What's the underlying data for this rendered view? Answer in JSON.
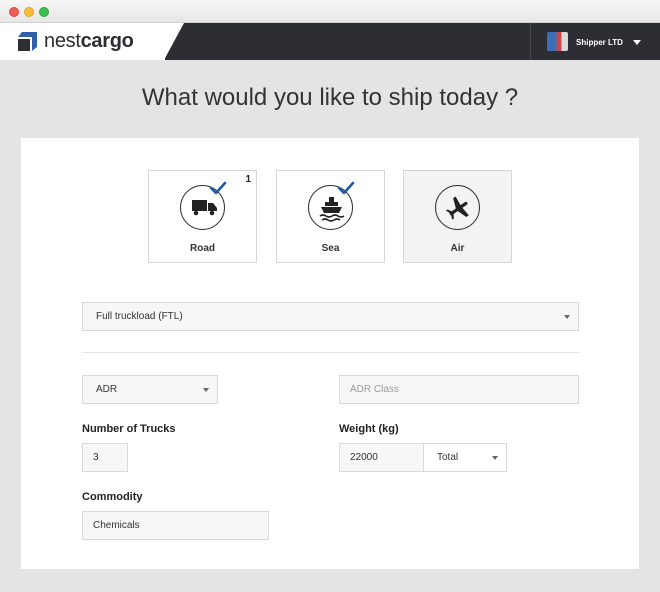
{
  "window": {
    "controls": [
      "close",
      "minimize",
      "maximize"
    ]
  },
  "topbar": {
    "logo_prefix": "nest",
    "logo_suffix": "cargo",
    "user_name": "Shipper LTD",
    "colors": {
      "bar": "#2d2e33",
      "logo_mark": "#2f5fa8"
    }
  },
  "title": "What would you like to ship today ?",
  "modes": [
    {
      "label": "Road",
      "icon": "truck-icon",
      "selected": true,
      "count": "1"
    },
    {
      "label": "Sea",
      "icon": "ship-icon",
      "selected": true,
      "count": ""
    },
    {
      "label": "Air",
      "icon": "plane-icon",
      "selected": false,
      "count": ""
    }
  ],
  "load_type": {
    "value": "Full truckload (FTL)"
  },
  "adr": {
    "value": "ADR",
    "class_placeholder": "ADR Class"
  },
  "trucks": {
    "label": "Number of Trucks",
    "value": "3"
  },
  "weight": {
    "label": "Weight (kg)",
    "value": "22000",
    "unit_value": "Total"
  },
  "commodity": {
    "label": "Commodity",
    "value": "Chemicals"
  },
  "colors": {
    "check": "#1f5aa6",
    "card": "#ffffff",
    "page_bg": "#e4e4e4"
  }
}
